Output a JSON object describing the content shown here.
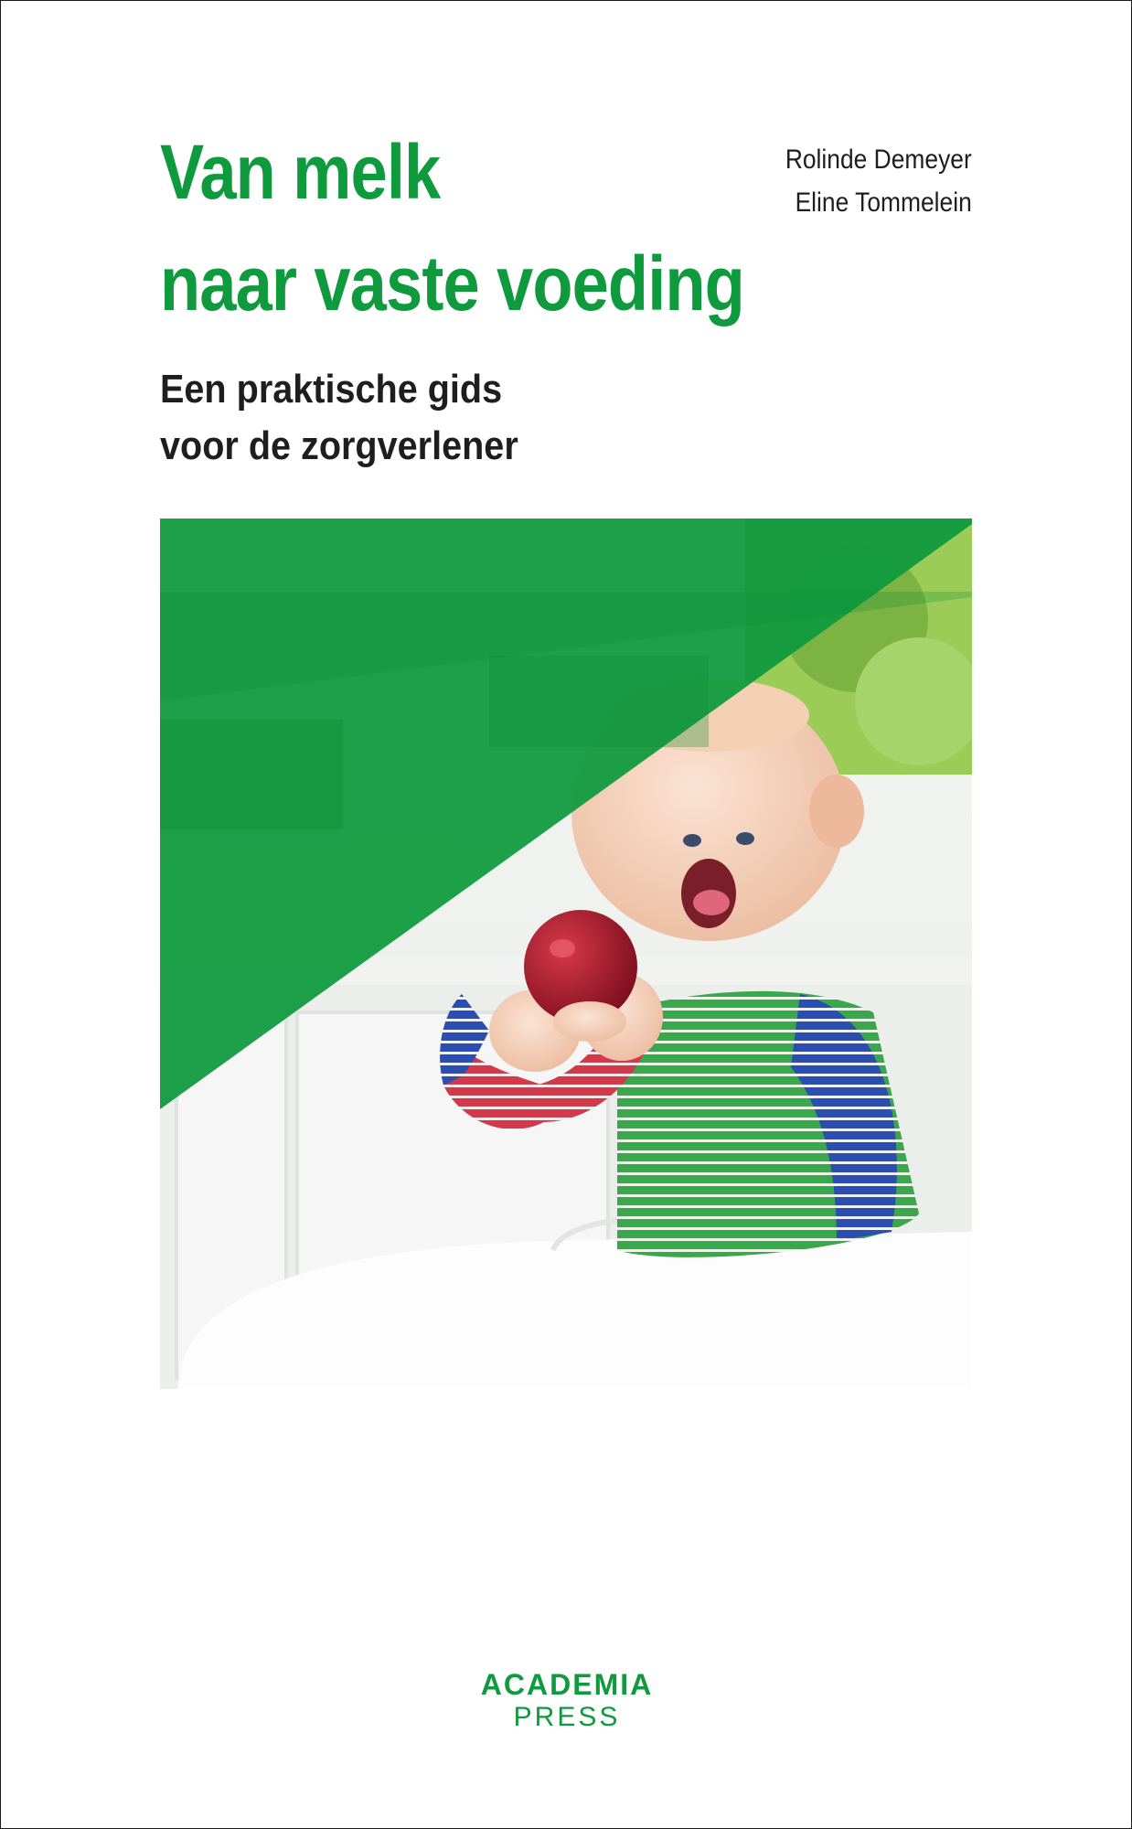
{
  "cover": {
    "title_lines": [
      "Van melk",
      "naar vaste voeding"
    ],
    "subtitle_lines": [
      "Een praktische gids",
      "voor de zorgverlener"
    ],
    "authors": [
      "Rolinde Demeyer",
      "Eline Tommelein"
    ],
    "publisher": {
      "line1": "ACADEMIA",
      "line2": "PRESS"
    },
    "photo_description_icon": "baby-eating-apple-photo",
    "colors": {
      "brand_green": "#0f9a3e",
      "text_dark": "#1e1e1e",
      "background": "#ffffff"
    }
  }
}
